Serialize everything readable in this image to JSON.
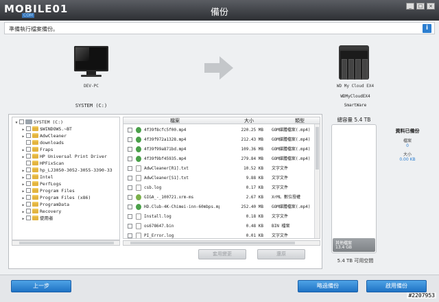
{
  "window": {
    "brand": "MOBILE01",
    "brand_sub": "COM",
    "title": "備份",
    "min": "_",
    "max": "□",
    "close": "×"
  },
  "info": {
    "text": "準備執行檔案備份。",
    "icon": "i"
  },
  "source": {
    "name": "DEV-PC",
    "drive": "SYSTEM (C:)"
  },
  "destination": {
    "name": "WD My Cloud EX4",
    "drive": "WDMyCloudEX4",
    "share": "SmartWare"
  },
  "tree": {
    "items": [
      {
        "label": "SYSTEM (C:)",
        "root": true,
        "expand": "▼"
      },
      {
        "label": "$WINDOWS.~BT",
        "expand": "▶"
      },
      {
        "label": "AdwCleaner",
        "expand": "▶"
      },
      {
        "label": "downloads",
        "expand": ""
      },
      {
        "label": "Fraps",
        "expand": "▶"
      },
      {
        "label": "HP Universal Print Driver",
        "expand": "▶"
      },
      {
        "label": "HPFixScan",
        "expand": ""
      },
      {
        "label": "hp_LJ3050-3052-3055-3390-33",
        "expand": "▶"
      },
      {
        "label": "Intel",
        "expand": "▶"
      },
      {
        "label": "PerfLogs",
        "expand": "▶"
      },
      {
        "label": "Program Files",
        "expand": "▶"
      },
      {
        "label": "Program Files (x86)",
        "expand": "▶"
      },
      {
        "label": "ProgramData",
        "expand": "▶"
      },
      {
        "label": "Recovery",
        "expand": "▶"
      },
      {
        "label": "使用者",
        "expand": "▶"
      }
    ]
  },
  "files": {
    "headers": {
      "name": "檔案",
      "size": "大小",
      "type": "類型"
    },
    "rows": [
      {
        "name": "4f39f8cfc5f00.mp4",
        "size": "220.25 MB",
        "type": "GOM媒體檔案(.mp4)",
        "icon": "media"
      },
      {
        "name": "4f39f972a1328.mp4",
        "size": "212.43 MB",
        "type": "GOM媒體檔案(.mp4)",
        "icon": "media"
      },
      {
        "name": "4f39f99a871bd.mp4",
        "size": "109.36 MB",
        "type": "GOM媒體檔案(.mp4)",
        "icon": "media"
      },
      {
        "name": "4f39f9bf45935.mp4",
        "size": "279.84 MB",
        "type": "GOM媒體檔案(.mp4)",
        "icon": "media"
      },
      {
        "name": "AdwCleaner[R1].txt",
        "size": "10.52 KB",
        "type": "文字文件",
        "icon": "txt"
      },
      {
        "name": "AdwCleaner[S1].txt",
        "size": "9.88 KB",
        "type": "文字文件",
        "icon": "txt"
      },
      {
        "name": "csb.log",
        "size": "0.17 KB",
        "type": "文字文件",
        "icon": "txt"
      },
      {
        "name": "GIGA_-_100721.xrm-ms",
        "size": "2.67 KB",
        "type": "XrML 數位授權",
        "icon": "xml"
      },
      {
        "name": "HD.Club-4K-Chimei-inn-60mbps.mp4",
        "size": "252.40 MB",
        "type": "GOM媒體檔案(.mp4)",
        "icon": "media"
      },
      {
        "name": "Install.log",
        "size": "0.18 KB",
        "type": "文字文件",
        "icon": "txt"
      },
      {
        "name": "os678647.bin",
        "size": "0.48 KB",
        "type": "BIN 檔案",
        "icon": "txt"
      },
      {
        "name": "PI_Error.log",
        "size": "0.01 KB",
        "type": "文字文件",
        "icon": "txt"
      }
    ]
  },
  "panel_buttons": {
    "apply": "套用變更",
    "cancel": "還原"
  },
  "selection": {
    "title": "總容量 5.4 TB",
    "fill_label1": "其他檔案",
    "fill_label2": "13.4 GB",
    "free": "5.4 TB 可用空間",
    "fill_fraction": 0.1
  },
  "stats": {
    "title": "資料已備份",
    "files_label": "檔案",
    "files_value": "0",
    "size_label": "大小",
    "size_value": "0.00 KB"
  },
  "bottom": {
    "back": "上一步",
    "skip": "略過備份",
    "start": "啟用備份"
  },
  "watermark": "#2207953",
  "colors": {
    "accent": "#2b7ed0",
    "button": "#1f72c4"
  }
}
